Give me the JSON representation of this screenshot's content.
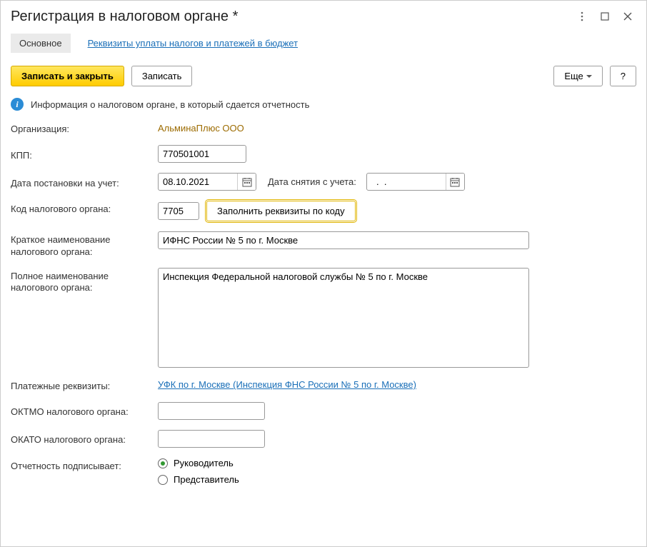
{
  "window": {
    "title": "Регистрация в налоговом органе *"
  },
  "tabs": {
    "main": "Основное",
    "requisites": "Реквизиты уплаты налогов и платежей в бюджет"
  },
  "toolbar": {
    "save_close": "Записать и закрыть",
    "save": "Записать",
    "more": "Еще",
    "help": "?"
  },
  "info": {
    "text": "Информация о налоговом органе, в который сдается отчетность"
  },
  "labels": {
    "organization": "Организация:",
    "kpp": "КПП:",
    "reg_date": "Дата постановки на учет:",
    "dereg_date": "Дата снятия с учета:",
    "tax_code": "Код налогового органа:",
    "fill_by_code": "Заполнить реквизиты по коду",
    "short_name": "Краткое наименование налогового органа:",
    "full_name": "Полное наименование налогового органа:",
    "payment": "Платежные реквизиты:",
    "oktmo": "ОКТМО налогового органа:",
    "okato": "ОКАТО налогового органа:",
    "signer": "Отчетность подписывает:"
  },
  "values": {
    "organization": "АльминаПлюс ООО",
    "kpp": "770501001",
    "reg_date": "08.10.2021",
    "dereg_date": "  .  .    ",
    "tax_code": "7705",
    "short_name": "ИФНС России № 5 по г. Москве",
    "full_name": "Инспекция Федеральной налоговой службы № 5 по г. Москве",
    "payment_link": "УФК по г. Москве (Инспекция ФНС России № 5 по г. Москве)",
    "oktmo": "",
    "okato": ""
  },
  "radio": {
    "head": "Руководитель",
    "representative": "Представитель"
  }
}
